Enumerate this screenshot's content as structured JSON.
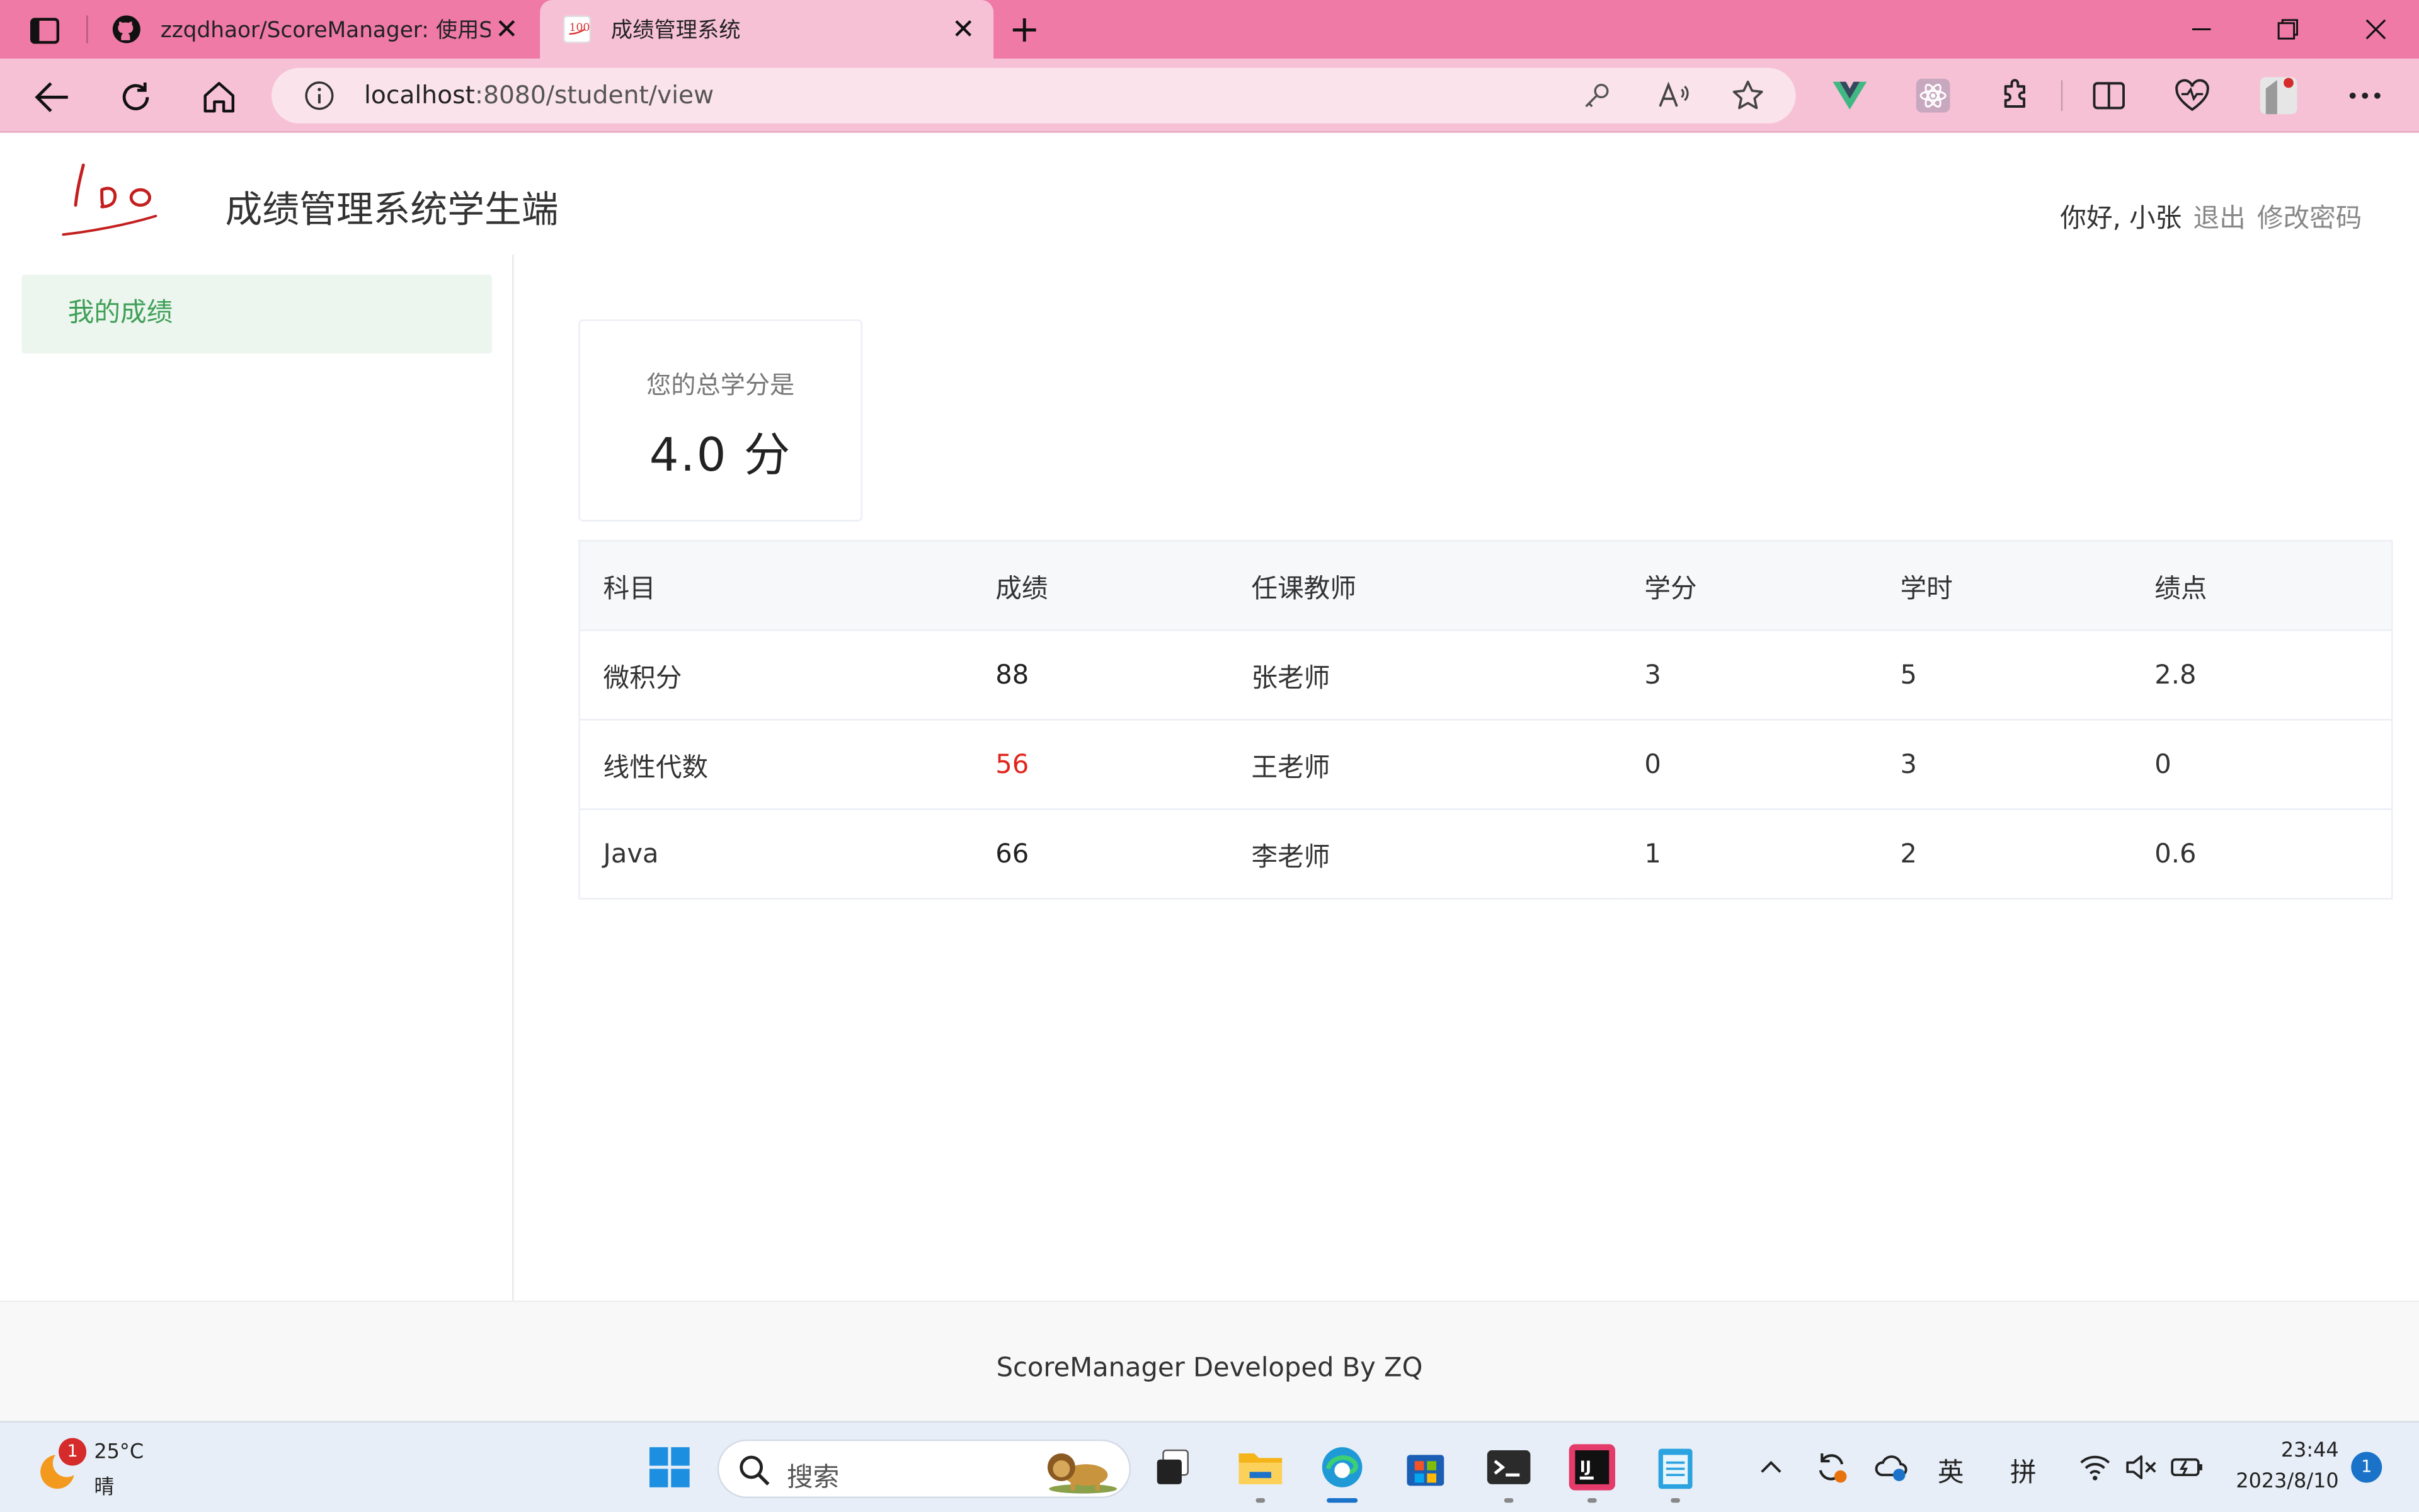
{
  "browser": {
    "tabs": [
      {
        "title": "zzqdhaor/ScoreManager: 使用Sp",
        "active": false
      },
      {
        "title": "成绩管理系统",
        "active": true
      }
    ],
    "url_host": "localhost",
    "url_rest": ":8080/student/view"
  },
  "header": {
    "site_title": "成绩管理系统学生端",
    "greeting": "你好, 小张",
    "logout": "退出",
    "change_password": "修改密码"
  },
  "sidebar": {
    "items": [
      {
        "label": "我的成绩",
        "active": true
      }
    ]
  },
  "credit_card": {
    "label": "您的总学分是",
    "value": "4.0 分"
  },
  "table": {
    "headers": [
      "科目",
      "成绩",
      "任课教师",
      "学分",
      "学时",
      "绩点"
    ],
    "rows": [
      {
        "subject": "微积分",
        "score": "88",
        "teacher": "张老师",
        "credit": "3",
        "hours": "5",
        "gpa": "2.8",
        "fail": false
      },
      {
        "subject": "线性代数",
        "score": "56",
        "teacher": "王老师",
        "credit": "0",
        "hours": "3",
        "gpa": "0",
        "fail": true
      },
      {
        "subject": "Java",
        "score": "66",
        "teacher": "李老师",
        "credit": "1",
        "hours": "2",
        "gpa": "0.6",
        "fail": false
      }
    ]
  },
  "footer": {
    "text": "ScoreManager Developed By ZQ"
  },
  "taskbar": {
    "weather_badge": "1",
    "weather_temp": "25°C",
    "weather_cond": "晴",
    "search_placeholder": "搜索",
    "lang_1": "英",
    "lang_2": "拼",
    "time": "23:44",
    "date": "2023/8/10",
    "notifications": "1"
  },
  "colors": {
    "tabbar": "#ee7aa5",
    "toolbar": "#f7c1d5",
    "sidebar_active_bg": "#ecf6ee",
    "sidebar_active_text": "#3f9f58",
    "fail_score": "#e1251b"
  }
}
